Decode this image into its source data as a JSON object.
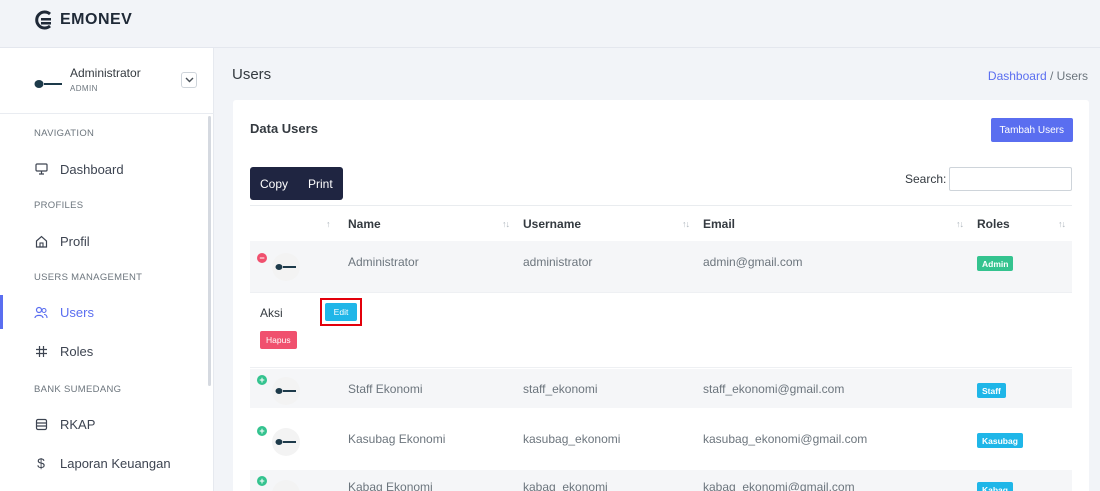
{
  "app": {
    "title": "EMONEV"
  },
  "user": {
    "name": "Administrator",
    "role": "ADMIN"
  },
  "sidebar": {
    "sections": [
      {
        "title": "NAVIGATION",
        "items": [
          {
            "label": "Dashboard",
            "icon": "monitor-icon"
          }
        ]
      },
      {
        "title": "PROFILES",
        "items": [
          {
            "label": "Profil",
            "icon": "home-icon"
          }
        ]
      },
      {
        "title": "USERS MANAGEMENT",
        "items": [
          {
            "label": "Users",
            "icon": "users-icon",
            "active": true
          },
          {
            "label": "Roles",
            "icon": "hash-icon"
          }
        ]
      },
      {
        "title": "BANK SUMEDANG",
        "items": [
          {
            "label": "RKAP",
            "icon": "database-icon"
          },
          {
            "label": "Laporan Keuangan",
            "icon": "dollar-icon"
          }
        ]
      }
    ]
  },
  "page": {
    "title": "Users",
    "breadcrumb": {
      "home": "Dashboard",
      "separator": " / ",
      "current": "Users"
    }
  },
  "card": {
    "title": "Data Users",
    "add_button": "Tambah Users",
    "buttons": {
      "copy": "Copy",
      "print": "Print"
    },
    "search_label": "Search:",
    "search_value": ""
  },
  "table": {
    "sort_glyph": "↑↓",
    "sort_first": "↑",
    "columns": [
      "Name",
      "Username",
      "Email",
      "Roles"
    ],
    "rows": [
      {
        "name": "Administrator",
        "username": "administrator",
        "email": "admin@gmail.com",
        "role": "Admin",
        "expanded": true
      },
      {
        "name": "Staff Ekonomi",
        "username": "staff_ekonomi",
        "email": "staff_ekonomi@gmail.com",
        "role": "Staff"
      },
      {
        "name": "Kasubag Ekonomi",
        "username": "kasubag_ekonomi",
        "email": "kasubag_ekonomi@gmail.com",
        "role": "Kasubag"
      },
      {
        "name": "Kabag Ekonomi",
        "username": "kabag_ekonomi",
        "email": "kabag_ekonomi@gmail.com",
        "role": "Kabag"
      }
    ],
    "child": {
      "label": "Aksi",
      "edit": "Edit",
      "delete": "Hapus"
    },
    "ctrl_minus": "−",
    "ctrl_plus": "+"
  },
  "colors": {
    "accent": "#5a6ef0",
    "dark_button": "#1f2541",
    "success": "#34c38f",
    "info": "#1fb6e8",
    "danger": "#f0506e"
  }
}
